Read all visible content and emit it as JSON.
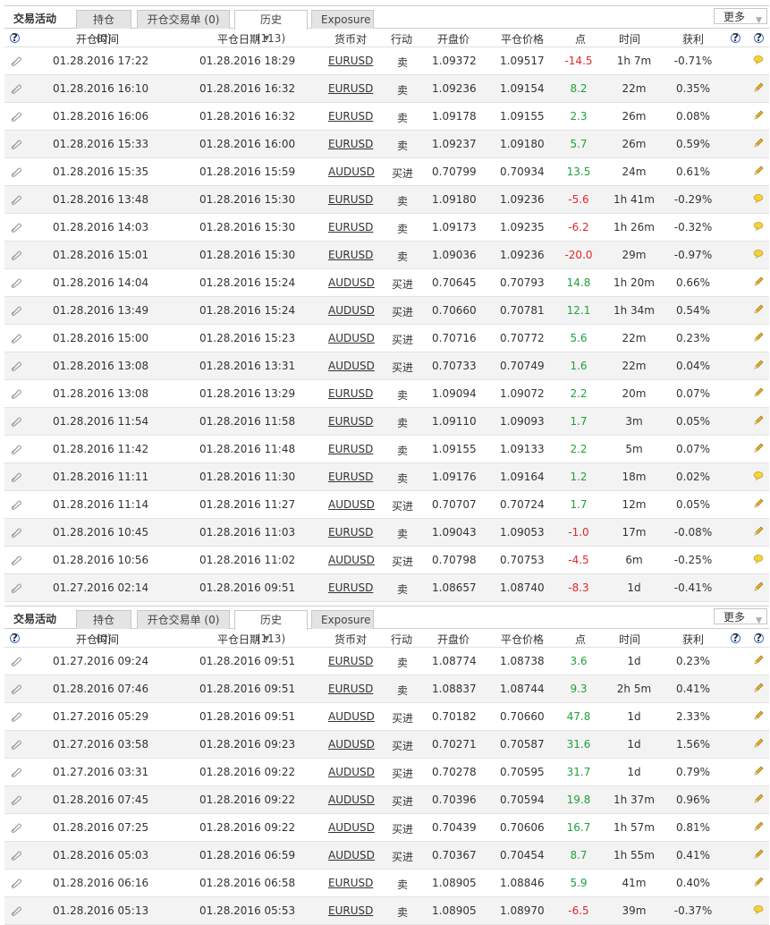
{
  "panels": [
    {
      "title": "交易活动",
      "tabs": [
        "持仓 (0)",
        "开仓交易单 (0)",
        "历史 (113)",
        "Exposure"
      ],
      "active_tab": 2,
      "more_label": "更多",
      "headers": {
        "open_time": "开仓时间",
        "close_date": "平仓日期",
        "symbol": "货币对",
        "action": "行动",
        "open_price": "开盘价",
        "close_price": "平仓价格",
        "points": "点",
        "duration": "时间",
        "profit": "获利"
      },
      "rows": [
        {
          "open": "01.28.2016 17:22",
          "close": "01.28.2016 18:29",
          "sym": "EURUSD",
          "act": "卖",
          "op": "1.09372",
          "cp": "1.09517",
          "pts": "-14.5",
          "dur": "1h 7m",
          "pct": "-0.71%",
          "icon": "comment"
        },
        {
          "open": "01.28.2016 16:10",
          "close": "01.28.2016 16:32",
          "sym": "EURUSD",
          "act": "卖",
          "op": "1.09236",
          "cp": "1.09154",
          "pts": "8.2",
          "dur": "22m",
          "pct": "0.35%",
          "icon": "pencil"
        },
        {
          "open": "01.28.2016 16:06",
          "close": "01.28.2016 16:32",
          "sym": "EURUSD",
          "act": "卖",
          "op": "1.09178",
          "cp": "1.09155",
          "pts": "2.3",
          "dur": "26m",
          "pct": "0.08%",
          "icon": "pencil"
        },
        {
          "open": "01.28.2016 15:33",
          "close": "01.28.2016 16:00",
          "sym": "EURUSD",
          "act": "卖",
          "op": "1.09237",
          "cp": "1.09180",
          "pts": "5.7",
          "dur": "26m",
          "pct": "0.59%",
          "icon": "pencil"
        },
        {
          "open": "01.28.2016 15:35",
          "close": "01.28.2016 15:59",
          "sym": "AUDUSD",
          "act": "买进",
          "op": "0.70799",
          "cp": "0.70934",
          "pts": "13.5",
          "dur": "24m",
          "pct": "0.61%",
          "icon": "pencil"
        },
        {
          "open": "01.28.2016 13:48",
          "close": "01.28.2016 15:30",
          "sym": "EURUSD",
          "act": "卖",
          "op": "1.09180",
          "cp": "1.09236",
          "pts": "-5.6",
          "dur": "1h 41m",
          "pct": "-0.29%",
          "icon": "comment"
        },
        {
          "open": "01.28.2016 14:03",
          "close": "01.28.2016 15:30",
          "sym": "EURUSD",
          "act": "卖",
          "op": "1.09173",
          "cp": "1.09235",
          "pts": "-6.2",
          "dur": "1h 26m",
          "pct": "-0.32%",
          "icon": "comment"
        },
        {
          "open": "01.28.2016 15:01",
          "close": "01.28.2016 15:30",
          "sym": "EURUSD",
          "act": "卖",
          "op": "1.09036",
          "cp": "1.09236",
          "pts": "-20.0",
          "dur": "29m",
          "pct": "-0.97%",
          "icon": "comment"
        },
        {
          "open": "01.28.2016 14:04",
          "close": "01.28.2016 15:24",
          "sym": "AUDUSD",
          "act": "买进",
          "op": "0.70645",
          "cp": "0.70793",
          "pts": "14.8",
          "dur": "1h 20m",
          "pct": "0.66%",
          "icon": "pencil"
        },
        {
          "open": "01.28.2016 13:49",
          "close": "01.28.2016 15:24",
          "sym": "AUDUSD",
          "act": "买进",
          "op": "0.70660",
          "cp": "0.70781",
          "pts": "12.1",
          "dur": "1h 34m",
          "pct": "0.54%",
          "icon": "pencil"
        },
        {
          "open": "01.28.2016 15:00",
          "close": "01.28.2016 15:23",
          "sym": "AUDUSD",
          "act": "买进",
          "op": "0.70716",
          "cp": "0.70772",
          "pts": "5.6",
          "dur": "22m",
          "pct": "0.23%",
          "icon": "pencil"
        },
        {
          "open": "01.28.2016 13:08",
          "close": "01.28.2016 13:31",
          "sym": "AUDUSD",
          "act": "买进",
          "op": "0.70733",
          "cp": "0.70749",
          "pts": "1.6",
          "dur": "22m",
          "pct": "0.04%",
          "icon": "pencil"
        },
        {
          "open": "01.28.2016 13:08",
          "close": "01.28.2016 13:29",
          "sym": "EURUSD",
          "act": "卖",
          "op": "1.09094",
          "cp": "1.09072",
          "pts": "2.2",
          "dur": "20m",
          "pct": "0.07%",
          "icon": "pencil"
        },
        {
          "open": "01.28.2016 11:54",
          "close": "01.28.2016 11:58",
          "sym": "EURUSD",
          "act": "卖",
          "op": "1.09110",
          "cp": "1.09093",
          "pts": "1.7",
          "dur": "3m",
          "pct": "0.05%",
          "icon": "pencil"
        },
        {
          "open": "01.28.2016 11:42",
          "close": "01.28.2016 11:48",
          "sym": "EURUSD",
          "act": "卖",
          "op": "1.09155",
          "cp": "1.09133",
          "pts": "2.2",
          "dur": "5m",
          "pct": "0.07%",
          "icon": "pencil"
        },
        {
          "open": "01.28.2016 11:11",
          "close": "01.28.2016 11:30",
          "sym": "EURUSD",
          "act": "卖",
          "op": "1.09176",
          "cp": "1.09164",
          "pts": "1.2",
          "dur": "18m",
          "pct": "0.02%",
          "icon": "comment"
        },
        {
          "open": "01.28.2016 11:14",
          "close": "01.28.2016 11:27",
          "sym": "AUDUSD",
          "act": "买进",
          "op": "0.70707",
          "cp": "0.70724",
          "pts": "1.7",
          "dur": "12m",
          "pct": "0.05%",
          "icon": "pencil"
        },
        {
          "open": "01.28.2016 10:45",
          "close": "01.28.2016 11:03",
          "sym": "EURUSD",
          "act": "卖",
          "op": "1.09043",
          "cp": "1.09053",
          "pts": "-1.0",
          "dur": "17m",
          "pct": "-0.08%",
          "icon": "pencil"
        },
        {
          "open": "01.28.2016 10:56",
          "close": "01.28.2016 11:02",
          "sym": "AUDUSD",
          "act": "买进",
          "op": "0.70798",
          "cp": "0.70753",
          "pts": "-4.5",
          "dur": "6m",
          "pct": "-0.25%",
          "icon": "comment"
        },
        {
          "open": "01.27.2016 02:14",
          "close": "01.28.2016 09:51",
          "sym": "EURUSD",
          "act": "卖",
          "op": "1.08657",
          "cp": "1.08740",
          "pts": "-8.3",
          "dur": "1d",
          "pct": "-0.41%",
          "icon": "pencil"
        }
      ]
    },
    {
      "title": "交易活动",
      "tabs": [
        "持仓 (0)",
        "开仓交易单 (0)",
        "历史 (113)",
        "Exposure"
      ],
      "active_tab": 2,
      "more_label": "更多",
      "headers": {
        "open_time": "开仓时间",
        "close_date": "平仓日期",
        "symbol": "货币对",
        "action": "行动",
        "open_price": "开盘价",
        "close_price": "平仓价格",
        "points": "点",
        "duration": "时间",
        "profit": "获利"
      },
      "rows": [
        {
          "open": "01.27.2016 09:24",
          "close": "01.28.2016 09:51",
          "sym": "EURUSD",
          "act": "卖",
          "op": "1.08774",
          "cp": "1.08738",
          "pts": "3.6",
          "dur": "1d",
          "pct": "0.23%",
          "icon": "pencil"
        },
        {
          "open": "01.28.2016 07:46",
          "close": "01.28.2016 09:51",
          "sym": "EURUSD",
          "act": "卖",
          "op": "1.08837",
          "cp": "1.08744",
          "pts": "9.3",
          "dur": "2h 5m",
          "pct": "0.41%",
          "icon": "pencil"
        },
        {
          "open": "01.27.2016 05:29",
          "close": "01.28.2016 09:51",
          "sym": "AUDUSD",
          "act": "买进",
          "op": "0.70182",
          "cp": "0.70660",
          "pts": "47.8",
          "dur": "1d",
          "pct": "2.33%",
          "icon": "pencil"
        },
        {
          "open": "01.27.2016 03:58",
          "close": "01.28.2016 09:23",
          "sym": "AUDUSD",
          "act": "买进",
          "op": "0.70271",
          "cp": "0.70587",
          "pts": "31.6",
          "dur": "1d",
          "pct": "1.56%",
          "icon": "pencil"
        },
        {
          "open": "01.27.2016 03:31",
          "close": "01.28.2016 09:22",
          "sym": "AUDUSD",
          "act": "买进",
          "op": "0.70278",
          "cp": "0.70595",
          "pts": "31.7",
          "dur": "1d",
          "pct": "0.79%",
          "icon": "pencil"
        },
        {
          "open": "01.28.2016 07:45",
          "close": "01.28.2016 09:22",
          "sym": "AUDUSD",
          "act": "买进",
          "op": "0.70396",
          "cp": "0.70594",
          "pts": "19.8",
          "dur": "1h 37m",
          "pct": "0.96%",
          "icon": "pencil"
        },
        {
          "open": "01.28.2016 07:25",
          "close": "01.28.2016 09:22",
          "sym": "AUDUSD",
          "act": "买进",
          "op": "0.70439",
          "cp": "0.70606",
          "pts": "16.7",
          "dur": "1h 57m",
          "pct": "0.81%",
          "icon": "pencil"
        },
        {
          "open": "01.28.2016 05:03",
          "close": "01.28.2016 06:59",
          "sym": "AUDUSD",
          "act": "买进",
          "op": "0.70367",
          "cp": "0.70454",
          "pts": "8.7",
          "dur": "1h 55m",
          "pct": "0.41%",
          "icon": "pencil"
        },
        {
          "open": "01.28.2016 06:16",
          "close": "01.28.2016 06:58",
          "sym": "EURUSD",
          "act": "卖",
          "op": "1.08905",
          "cp": "1.08846",
          "pts": "5.9",
          "dur": "41m",
          "pct": "0.40%",
          "icon": "pencil"
        },
        {
          "open": "01.28.2016 05:13",
          "close": "01.28.2016 05:53",
          "sym": "EURUSD",
          "act": "卖",
          "op": "1.08905",
          "cp": "1.08970",
          "pts": "-6.5",
          "dur": "39m",
          "pct": "-0.37%",
          "icon": "comment"
        }
      ]
    }
  ],
  "colors": {
    "positive": "#22a03c",
    "negative": "#e02828",
    "help": "#3a6fd0"
  }
}
